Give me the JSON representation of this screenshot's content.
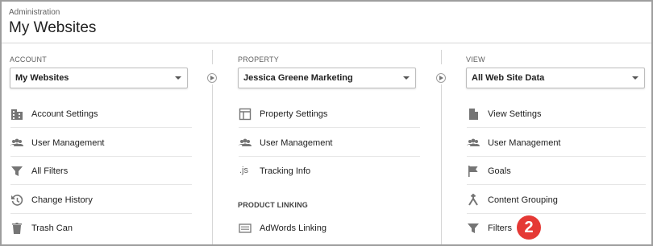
{
  "header": {
    "breadcrumb": "Administration",
    "title": "My Websites"
  },
  "account": {
    "label": "ACCOUNT",
    "selected": "My Websites",
    "items": [
      {
        "label": "Account Settings",
        "icon": "building-icon"
      },
      {
        "label": "User Management",
        "icon": "people-icon"
      },
      {
        "label": "All Filters",
        "icon": "filter-icon"
      },
      {
        "label": "Change History",
        "icon": "history-icon"
      },
      {
        "label": "Trash Can",
        "icon": "trash-icon"
      }
    ]
  },
  "property": {
    "label": "PROPERTY",
    "selected": "Jessica Greene Marketing",
    "items": [
      {
        "label": "Property Settings",
        "icon": "layout-icon"
      },
      {
        "label": "User Management",
        "icon": "people-icon"
      },
      {
        "label": "Tracking Info",
        "icon": "js-icon",
        "glyph": ".js"
      }
    ],
    "section": "PRODUCT LINKING",
    "linking": [
      {
        "label": "AdWords Linking",
        "icon": "adwords-icon"
      }
    ]
  },
  "view": {
    "label": "VIEW",
    "selected": "All Web Site Data",
    "items": [
      {
        "label": "View Settings",
        "icon": "document-icon"
      },
      {
        "label": "User Management",
        "icon": "people-icon"
      },
      {
        "label": "Goals",
        "icon": "flag-icon"
      },
      {
        "label": "Content Grouping",
        "icon": "grouping-icon"
      },
      {
        "label": "Filters",
        "icon": "filter-icon"
      }
    ]
  },
  "annotation": {
    "number": "2",
    "color": "#e53935"
  }
}
